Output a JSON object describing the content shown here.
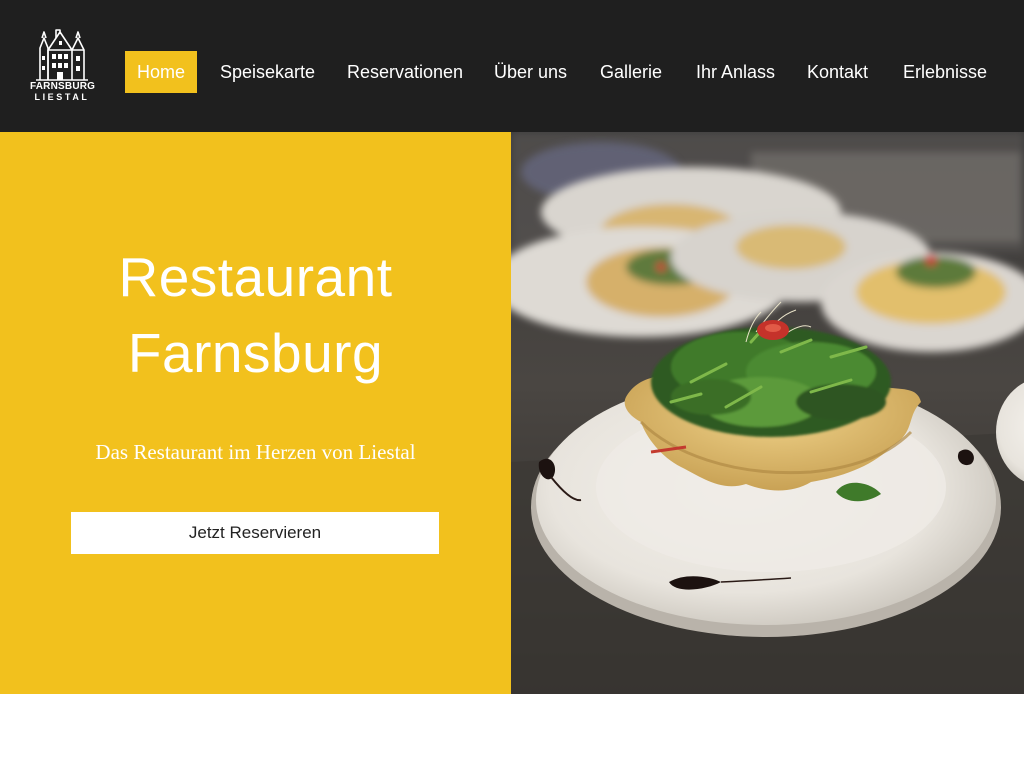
{
  "brand": {
    "logo_line1": "FARNSBURG",
    "logo_line2": "LIESTAL"
  },
  "nav": {
    "items": [
      {
        "label": "Home",
        "active": true
      },
      {
        "label": "Speisekarte"
      },
      {
        "label": "Reservationen"
      },
      {
        "label": "Über uns"
      },
      {
        "label": "Gallerie"
      },
      {
        "label": "Ihr Anlass"
      },
      {
        "label": "Kontakt"
      },
      {
        "label": "Erlebnisse"
      }
    ]
  },
  "hero": {
    "title_line1": "Restaurant",
    "title_line2": "Farnsburg",
    "subtitle": "Das Restaurant im Herzen von Liestal",
    "cta_label": "Jetzt Reservieren"
  },
  "colors": {
    "header_bg": "#1f1f1f",
    "accent_yellow": "#f2c11d",
    "text_light": "#ffffff",
    "button_bg": "#ffffff"
  },
  "icons": {
    "logo": "castle-building-logo",
    "hero_image": "salad-in-parmesan-basket-photo"
  }
}
